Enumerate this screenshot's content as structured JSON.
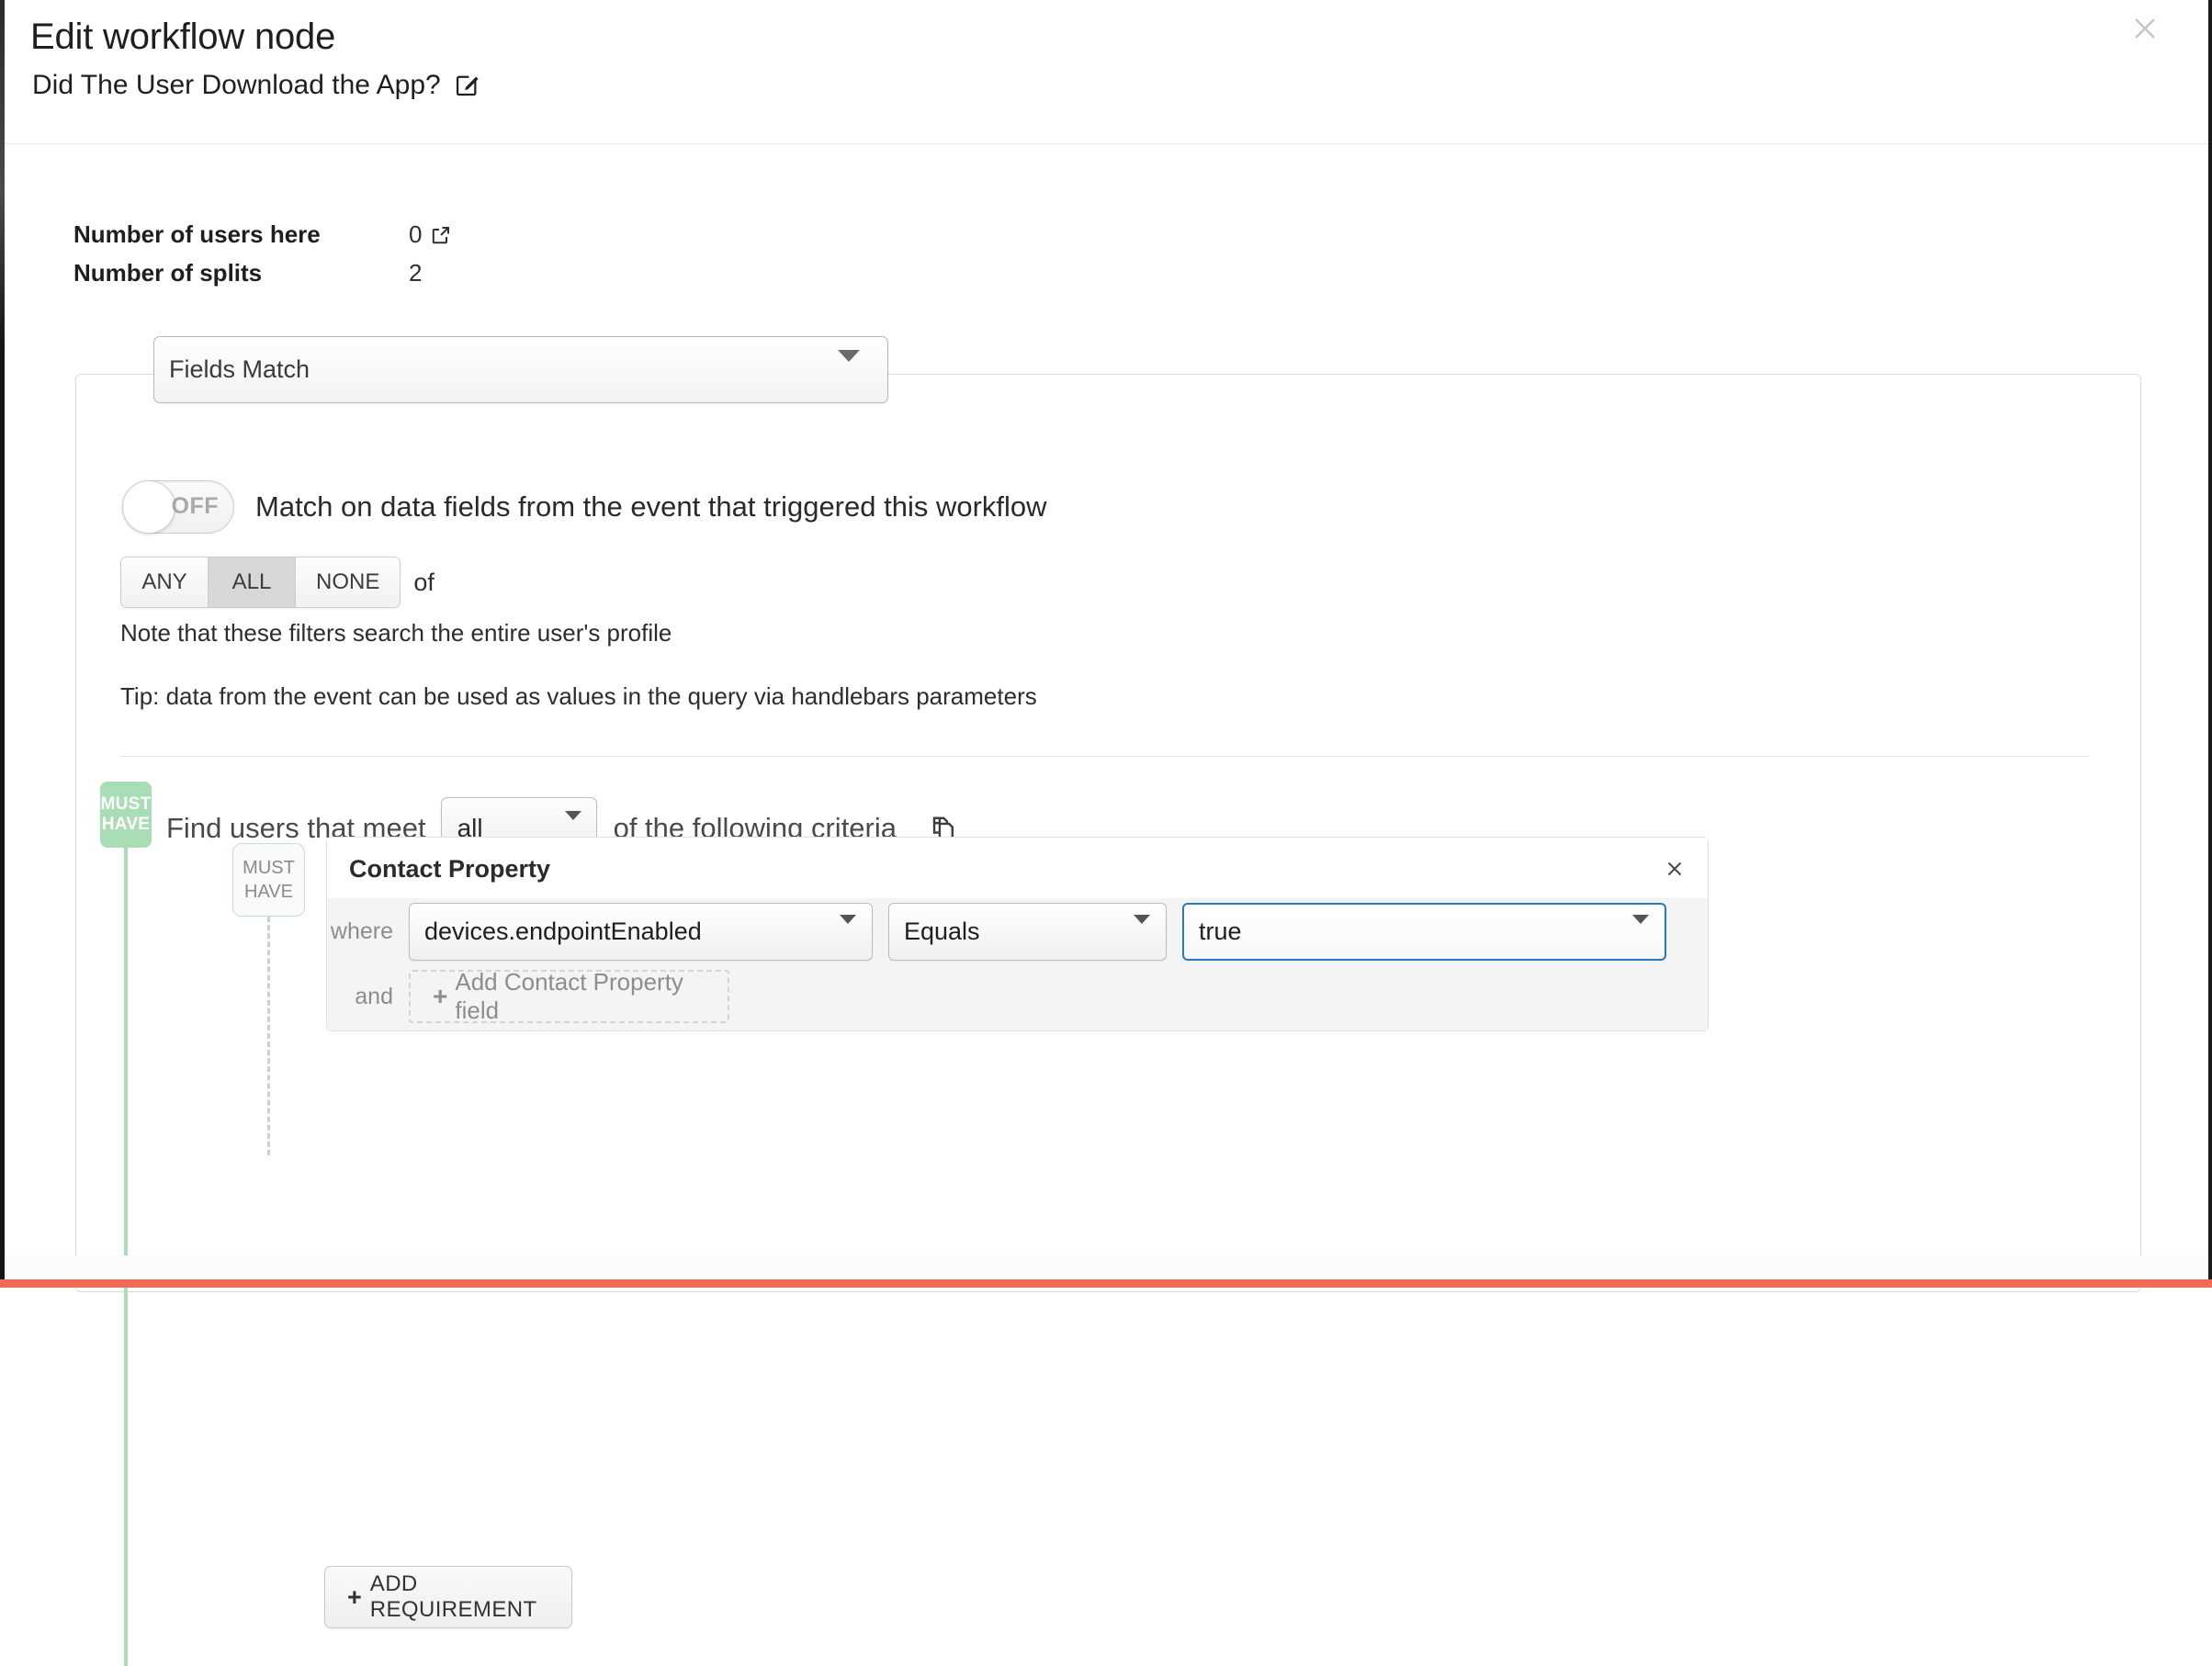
{
  "header": {
    "title": "Edit workflow node",
    "subtitle": "Did The User Download the App?",
    "edit_icon": "pencil-square-icon",
    "close_icon": "close-icon"
  },
  "stats": [
    {
      "label": "Number of users here",
      "value": "0",
      "has_link": true,
      "link_icon": "external-link-icon"
    },
    {
      "label": "Number of splits",
      "value": "2",
      "has_link": false
    }
  ],
  "node_type_select": {
    "value": "Fields Match",
    "caret_icon": "chevron-down-icon"
  },
  "match_toggle": {
    "state_label": "OFF",
    "description": "Match on data fields from the event that triggered this workflow"
  },
  "match_mode": {
    "options": [
      "ANY",
      "ALL",
      "NONE"
    ],
    "selected": "ALL",
    "suffix": "of"
  },
  "note_text": "Note that these filters search the entire user's profile",
  "tip_text": "Tip: data from the event can be used as values in the query via handlebars parameters",
  "must_have_badge": {
    "line1": "MUST",
    "line2": "HAVE"
  },
  "criteria": {
    "lead_text": "Find users that meet",
    "match_select": {
      "value": "all",
      "caret_icon": "chevron-down-icon"
    },
    "tail_text": "of the following criteria",
    "copy_icon": "copy-duplicate-icon"
  },
  "inner_badge": {
    "line1": "MUST",
    "line2": "HAVE"
  },
  "contact_property_card": {
    "title": "Contact Property",
    "close_icon": "close-icon",
    "rows": [
      {
        "keyword": "where",
        "field_select": {
          "value": "devices.endpointEnabled",
          "caret_icon": "chevron-down-icon"
        },
        "operator_select": {
          "value": "Equals",
          "caret_icon": "chevron-down-icon"
        },
        "value_select": {
          "value": "true",
          "caret_icon": "chevron-down-icon",
          "focus_color": "#2a7bbd"
        }
      },
      {
        "keyword": "and",
        "add_field_label": "Add Contact Property field",
        "add_field_plus": "+"
      }
    ]
  },
  "add_requirement_button": {
    "plus": "+",
    "label": "ADD REQUIREMENT"
  },
  "colors": {
    "must_have_green": "#a8ddb5",
    "focus_blue": "#2a7bbd",
    "bottom_accent_red": "#ef6a57"
  }
}
